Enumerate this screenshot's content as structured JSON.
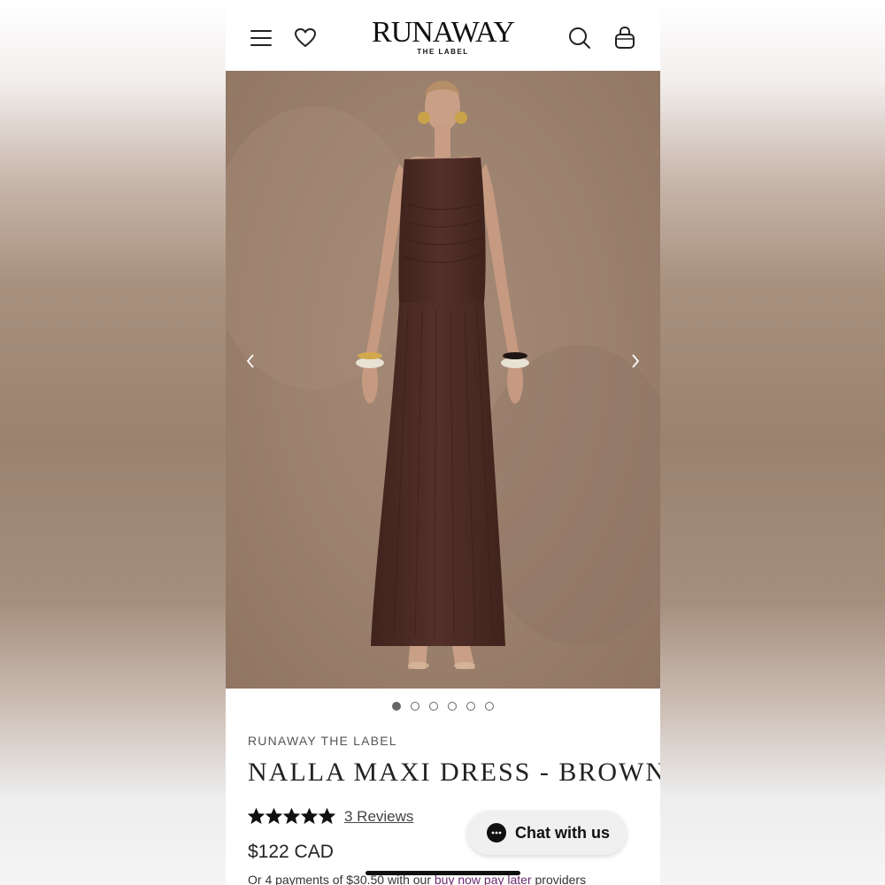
{
  "header": {
    "logo_main": "RUNAWAY",
    "logo_sub": "THE LABEL"
  },
  "product": {
    "brand": "RUNAWAY THE LABEL",
    "title": "NALLA MAXI DRESS - BROWN",
    "rating": 5,
    "rating_max": 5,
    "reviews_label": "3 Reviews",
    "price": "$122 CAD",
    "installments_prefix": "Or 4 payments of $30.50 with our ",
    "installments_link": "buy now pay later",
    "installments_suffix": " providers"
  },
  "carousel": {
    "total_images": 6,
    "active_index": 0
  },
  "chat": {
    "label": "Chat with us"
  },
  "icons": {
    "menu": "hamburger-icon",
    "wishlist": "heart-icon",
    "search": "search-icon",
    "cart": "shopping-bag-icon",
    "prev": "chevron-left-icon",
    "next": "chevron-right-icon",
    "chat": "chat-bubble-icon"
  },
  "colors": {
    "dress": "#4a2a22",
    "backdrop": "#9d8270",
    "link": "#6b2a6e"
  }
}
